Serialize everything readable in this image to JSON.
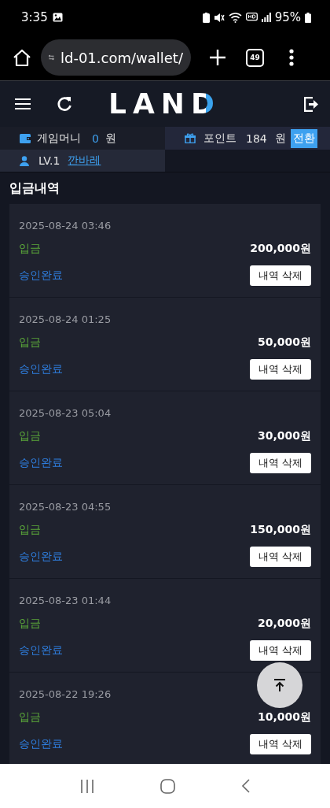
{
  "status_bar": {
    "time": "3:35",
    "battery": "95%"
  },
  "browser": {
    "url": "ld-01.com/wallet/",
    "tab_count": "49"
  },
  "header": {
    "logo": "LAND"
  },
  "wallet": {
    "game_money_label": "게임머니",
    "game_money": "0",
    "game_money_unit": "원",
    "points_label": "포인트",
    "points": "184",
    "points_unit": "원",
    "convert_button": "전환",
    "level": "LV.1",
    "username": "깐바레"
  },
  "section_title": "입금내역",
  "deposits": [
    {
      "datetime": "2025-08-24 03:46",
      "type": "입금",
      "amount": "200,000원",
      "status": "승인완료",
      "delete_button": "내역 삭제"
    },
    {
      "datetime": "2025-08-24 01:25",
      "type": "입금",
      "amount": "50,000원",
      "status": "승인완료",
      "delete_button": "내역 삭제"
    },
    {
      "datetime": "2025-08-23 05:04",
      "type": "입금",
      "amount": "30,000원",
      "status": "승인완료",
      "delete_button": "내역 삭제"
    },
    {
      "datetime": "2025-08-23 04:55",
      "type": "입금",
      "amount": "150,000원",
      "status": "승인완료",
      "delete_button": "내역 삭제"
    },
    {
      "datetime": "2025-08-23 01:44",
      "type": "입금",
      "amount": "20,000원",
      "status": "승인완료",
      "delete_button": "내역 삭제"
    },
    {
      "datetime": "2025-08-22 19:26",
      "type": "입금",
      "amount": "10,000원",
      "status": "승인완료",
      "delete_button": "내역 삭제"
    }
  ]
}
